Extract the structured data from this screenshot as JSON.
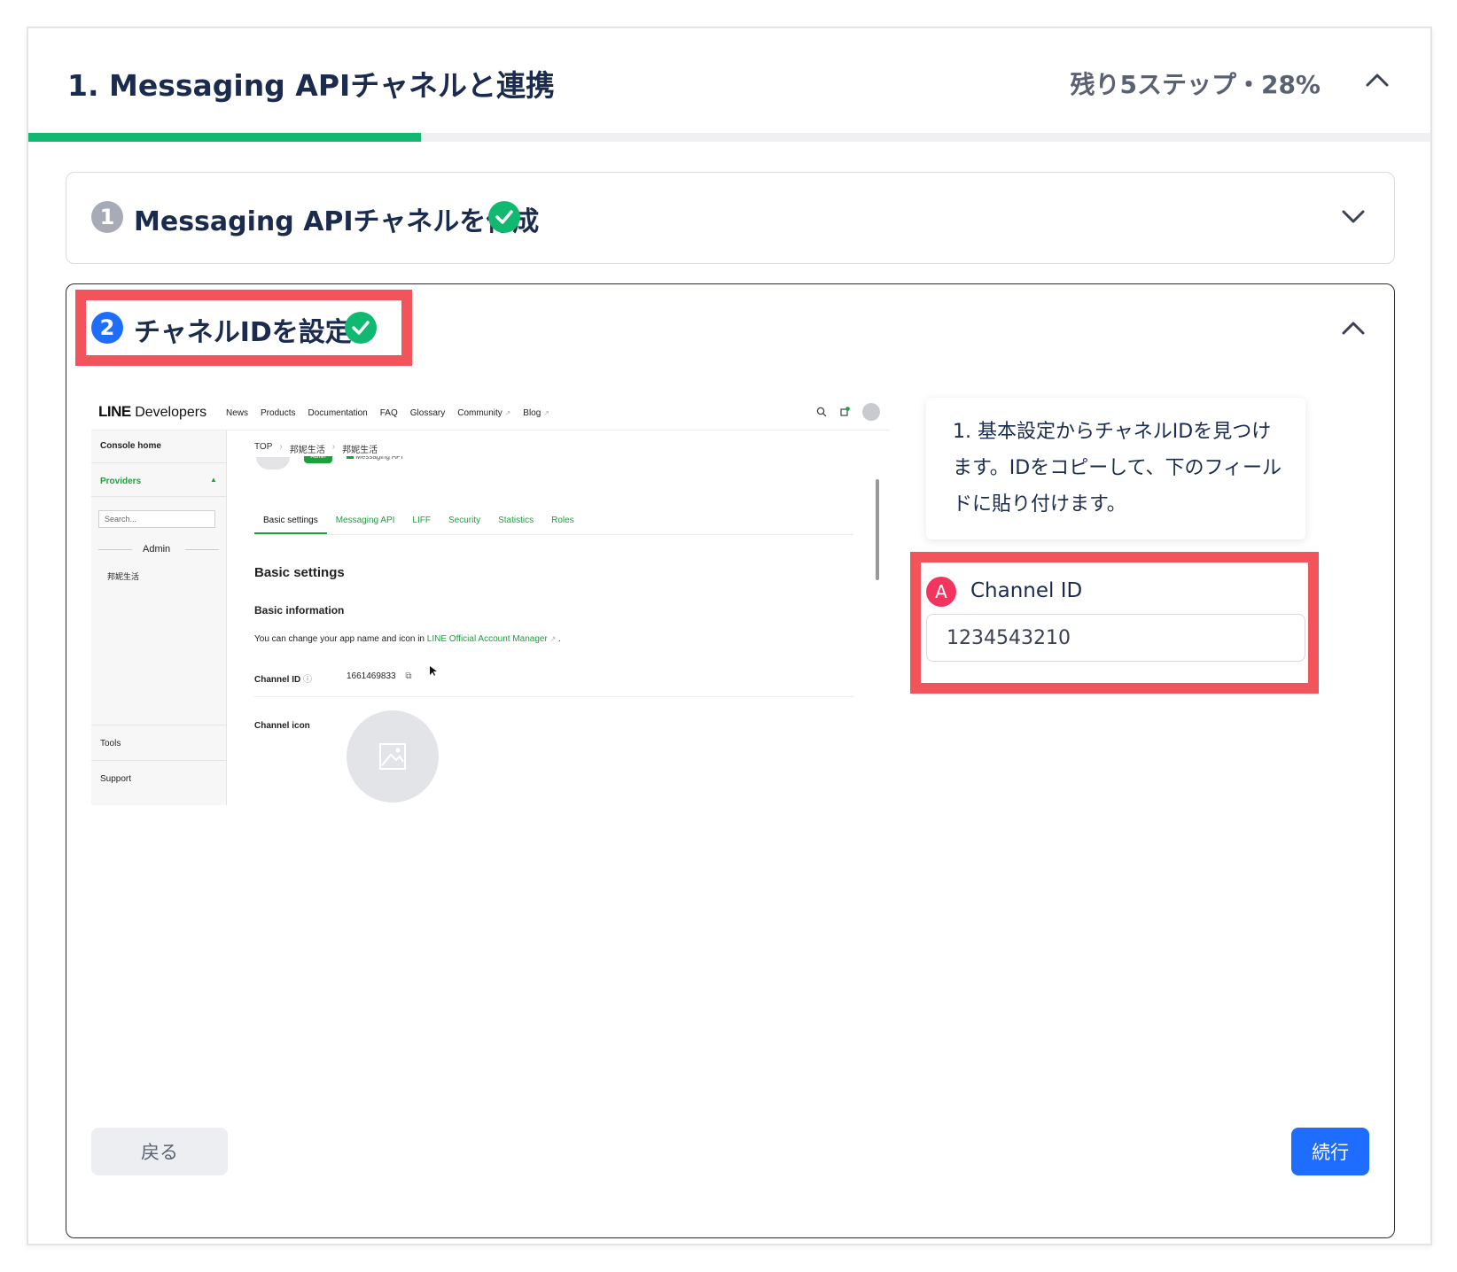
{
  "header": {
    "title": "1. Messaging APIチャネルと連携",
    "progress_text": "残り5ステップ・28%",
    "progress_fraction": 0.28
  },
  "step1": {
    "number": "1",
    "title": "Messaging APIチャネルを作成"
  },
  "step2": {
    "number": "2",
    "title": "チャネルIDを設定",
    "instruction": "1. 基本設定からチャネルIDを見つけます。IDをコピーして、下のフィールドに貼り付けます。",
    "field_marker": "A",
    "field_label": "Channel ID",
    "field_value": "1234543210",
    "back_label": "戻る",
    "next_label": "続行"
  },
  "screenshot": {
    "logo_bold": "LINE",
    "logo_rest": "Developers",
    "nav": [
      "News",
      "Products",
      "Documentation",
      "FAQ",
      "Glossary",
      "Community",
      "Blog"
    ],
    "sidebar": {
      "console_home": "Console home",
      "providers": "Providers",
      "search_placeholder": "Search...",
      "admin": "Admin",
      "provider_name": "邦妮生活",
      "tools": "Tools",
      "support": "Support"
    },
    "breadcrumb": [
      "TOP",
      "邦妮生活",
      "邦妮生活"
    ],
    "badge": "Admin",
    "channel_type": "Messaging API",
    "tabs": [
      "Basic settings",
      "Messaging API",
      "LIFF",
      "Security",
      "Statistics",
      "Roles"
    ],
    "section_title": "Basic settings",
    "subsection_title": "Basic information",
    "info_text": "You can change your app name and icon in",
    "info_link": "LINE Official Account Manager",
    "channel_id_label": "Channel ID",
    "channel_id_value": "1661469833",
    "channel_icon_label": "Channel icon"
  },
  "colors": {
    "accent_green": "#10b96f",
    "primary_blue": "#1f6dff",
    "highlight_red": "#f2545b",
    "marker_pink": "#f2345f",
    "line_green": "#17a33a"
  }
}
